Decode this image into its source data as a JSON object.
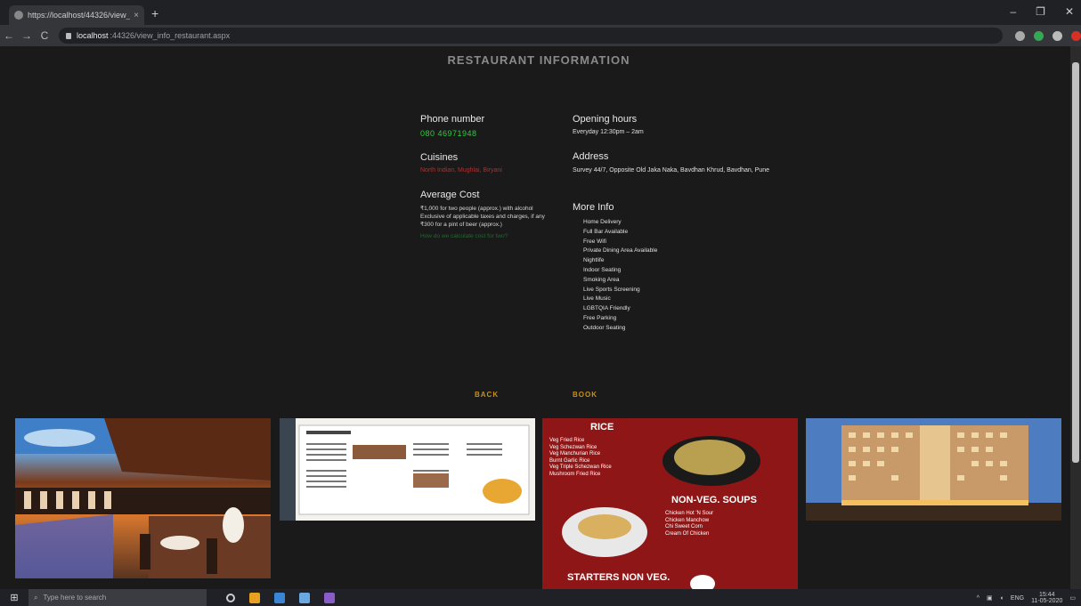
{
  "browser": {
    "tab_title": "https://localhost/44326/view_sr...",
    "tab_close": "×",
    "new_tab": "+",
    "url_host": "localhost",
    "url_path": ":44326/view_info_restaurant.aspx",
    "nav": {
      "back": "←",
      "forward": "→",
      "reload": "C"
    },
    "window_controls": [
      "–",
      "❐",
      "✕"
    ]
  },
  "page": {
    "title": "RESTAURANT INFORMATION",
    "phone": {
      "label": "Phone number",
      "value": "080 46971948"
    },
    "cuisines": {
      "label": "Cuisines",
      "value": "North Indian, Mughlai, Biryani"
    },
    "cost": {
      "label": "Average Cost",
      "line1": "₹1,000 for two people (approx.) with alcohol",
      "line2": "Exclusive of applicable taxes and charges, if any",
      "line3": "₹300 for a pint of beer (approx.)",
      "link": "How do we calculate cost for two?"
    },
    "hours": {
      "label": "Opening hours",
      "value": "Everyday 12:30pm – 2am"
    },
    "address": {
      "label": "Address",
      "value": "Survey 44/7, Opposite Old Jaka Naka, Bavdhan Khrud, Bavdhan, Pune"
    },
    "more_info": {
      "label": "More Info",
      "items": [
        "Home Delivery",
        "Full Bar Available",
        "Free Wifi",
        "Private Dining Area Available",
        "Nightlife",
        "Indoor Seating",
        "Smoking Area",
        "Live Sports Screening",
        "Live Music",
        "LGBTQIA Friendly",
        "Free Parking",
        "Outdoor Seating"
      ]
    },
    "buttons": {
      "back": "BACK",
      "book": "BOOK"
    },
    "menu_images": {
      "rice_heading": "RICE",
      "rice_items": [
        "Veg Fried Rice",
        "Veg Schezwan Rice",
        "Veg Manchurian Rice",
        "Burnt Garlic Rice",
        "Veg Triple Schezwan Rice",
        "Mushroom Fried Rice"
      ],
      "soups_heading": "NON-VEG. SOUPS",
      "soups_items": [
        "Chicken Hot 'N Sour",
        "Chicken Manchow",
        "Chi Sweet Corn",
        "Cream Of Chicken"
      ],
      "starters_heading": "STARTERS NON VEG."
    }
  },
  "taskbar": {
    "search_placeholder": "Type here to search",
    "time": "15:44",
    "date": "11-05-2020",
    "lang": "ENG"
  }
}
